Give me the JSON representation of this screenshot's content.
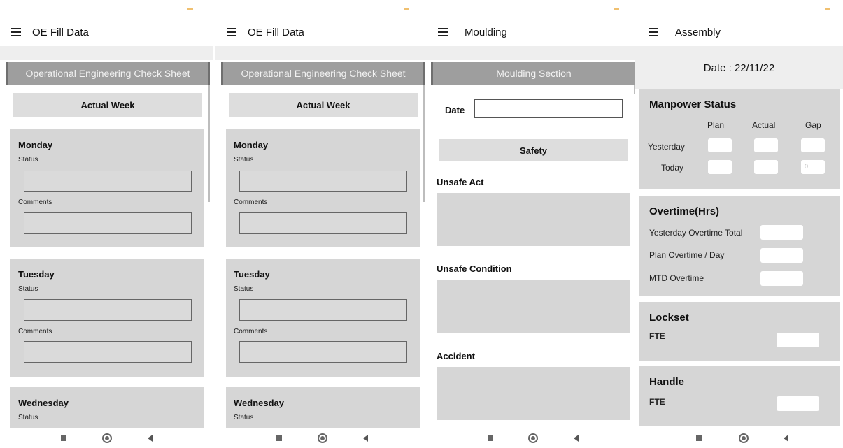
{
  "screen1": {
    "app_title": "OE Fill Data",
    "header": "Operational Engineering Check Sheet",
    "week_button": "Actual Week",
    "days": [
      {
        "name": "Monday",
        "status_label": "Status",
        "comments_label": "Comments"
      },
      {
        "name": "Tuesday",
        "status_label": "Status",
        "comments_label": "Comments"
      },
      {
        "name": "Wednesday",
        "status_label": "Status"
      }
    ]
  },
  "screen2": {
    "app_title": "OE Fill Data",
    "header": "Operational Engineering Check Sheet",
    "week_button": "Actual Week",
    "days": [
      {
        "name": "Monday",
        "status_label": "Status",
        "comments_label": "Comments"
      },
      {
        "name": "Tuesday",
        "status_label": "Status",
        "comments_label": "Comments"
      },
      {
        "name": "Wednesday",
        "status_label": "Status"
      }
    ]
  },
  "screen3": {
    "app_title": "Moulding",
    "header": "Moulding Section",
    "date_label": "Date",
    "date_value": "",
    "safety_button": "Safety",
    "sections": [
      "Unsafe Act",
      "Unsafe Condition",
      "Accident"
    ]
  },
  "screen4": {
    "app_title": "Assembly",
    "date_text": "Date : 22/11/22",
    "manpower": {
      "title": "Manpower Status",
      "columns": [
        "Plan",
        "Actual",
        "Gap"
      ],
      "rows": [
        "Yesterday",
        "Today"
      ],
      "today_gap_placeholder": "0"
    },
    "overtime": {
      "title": "Overtime(Hrs)",
      "rows": [
        "Yesterday Overtime Total",
        "Plan Overtime / Day",
        "MTD Overtime"
      ]
    },
    "lockset": {
      "title": "Lockset",
      "fte_label": "FTE"
    },
    "handle": {
      "title": "Handle",
      "fte_label": "FTE"
    }
  },
  "colors": {
    "header_band": "#9e9e9e",
    "card": "#d6d6d6",
    "light_strip": "#eeeeee"
  }
}
